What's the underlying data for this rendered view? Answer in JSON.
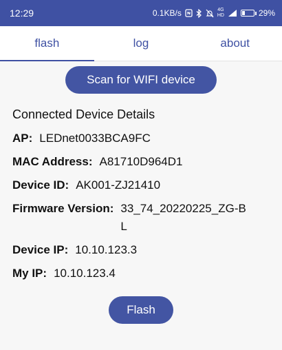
{
  "status_bar": {
    "time": "12:29",
    "net_speed": "0.1KB/s",
    "net_type_top": "4G",
    "net_type_bottom": "HD",
    "battery_percent": "29%",
    "battery_level": 0.29
  },
  "tabs": [
    {
      "label": "flash",
      "active": true
    },
    {
      "label": "log",
      "active": false
    },
    {
      "label": "about",
      "active": false
    }
  ],
  "scan_button": "Scan for WIFI device",
  "section_title": "Connected Device Details",
  "details": {
    "ap": {
      "label": "AP:",
      "value": "LEDnet0033BCA9FC"
    },
    "mac": {
      "label": "MAC Address:",
      "value": "A81710D964D1"
    },
    "device_id": {
      "label": "Device ID:",
      "value": "AK001-ZJ21410"
    },
    "firmware": {
      "label": "Firmware Version:",
      "value": "33_74_20220225_ZG-BL"
    },
    "device_ip": {
      "label": "Device IP:",
      "value": "10.10.123.3"
    },
    "my_ip": {
      "label": "My IP:",
      "value": "10.10.123.4"
    }
  },
  "flash_button": "Flash",
  "colors": {
    "primary": "#3f51a3",
    "button": "#4355a3",
    "background": "#f7f7f7"
  }
}
